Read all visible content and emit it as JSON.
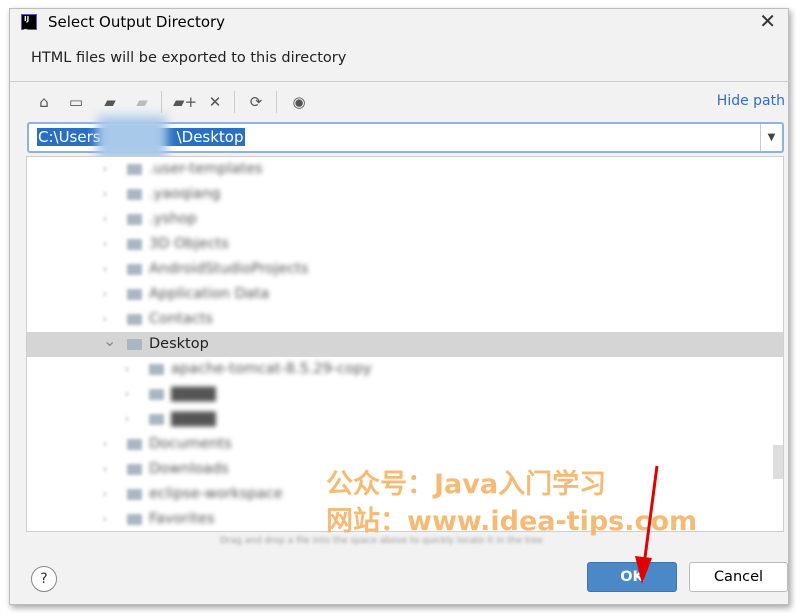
{
  "window": {
    "title": "Select Output Directory",
    "close_icon": "close-icon"
  },
  "description": "HTML files will be exported to this directory",
  "toolbar": {
    "icons": [
      "home-icon",
      "desktop-icon",
      "project-folder-icon",
      "module-folder-icon",
      "new-folder-icon",
      "delete-icon",
      "refresh-icon",
      "show-hidden-icon"
    ],
    "hide_path": "Hide path"
  },
  "path": {
    "prefix": "C:\\Users",
    "suffix": "\\Desktop"
  },
  "tree": {
    "items": [
      {
        "label": ".user-templates",
        "level": 1
      },
      {
        "label": ".yaoqiang",
        "level": 1
      },
      {
        "label": ".yshop",
        "level": 1
      },
      {
        "label": "3D Objects",
        "level": 1
      },
      {
        "label": "AndroidStudioProjects",
        "level": 1
      },
      {
        "label": "Application Data",
        "level": 1
      },
      {
        "label": "Contacts",
        "level": 1
      },
      {
        "label": "Desktop",
        "level": 1,
        "expanded": true,
        "selected": true
      },
      {
        "label": "apache-tomcat-8.5.29-copy",
        "level": 2
      },
      {
        "label": "▇▇▇▇",
        "level": 2
      },
      {
        "label": "▇▇▇▇",
        "level": 2
      },
      {
        "label": "Documents",
        "level": 1
      },
      {
        "label": "Downloads",
        "level": 1
      },
      {
        "label": "eclipse-workspace",
        "level": 1
      },
      {
        "label": "Favorites",
        "level": 1
      }
    ]
  },
  "hint": "Drag and drop a file into the space above to quickly locate it in the tree",
  "buttons": {
    "help": "?",
    "ok": "OK",
    "cancel": "Cancel"
  },
  "watermark": {
    "line1": "公众号：Java入门学习",
    "line2": "网站：www.idea-tips.com"
  },
  "colors": {
    "accent": "#4a88c7",
    "selection": "#2a6fc1",
    "watermark": "#f5b56a",
    "arrow": "#e00000"
  }
}
